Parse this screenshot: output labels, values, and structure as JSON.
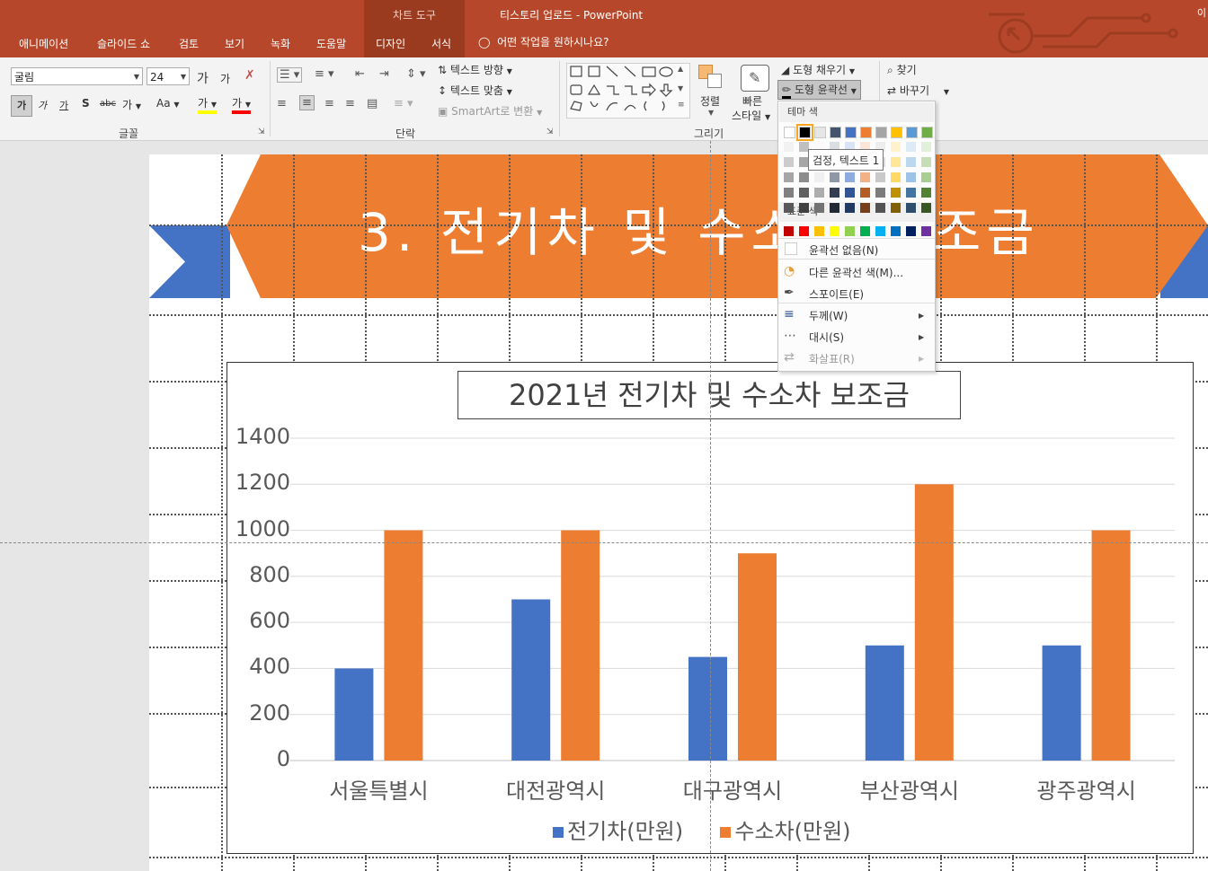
{
  "titlebar": {
    "tool_context": "차트 도구",
    "document_title": "티스토리 업로드  -  PowerPoint",
    "user": "이",
    "tabs": [
      "애니메이션",
      "슬라이드 쇼",
      "검토",
      "보기",
      "녹화",
      "도움말",
      "디자인",
      "서식"
    ],
    "tell_me": "어떤 작업을 원하시나요?",
    "accent": "#b7472a"
  },
  "ribbon": {
    "font": {
      "name": "굴림",
      "size": "24",
      "increase": "가",
      "decrease": "가",
      "bold": "가",
      "italic": "가",
      "underline": "가",
      "shadow": "S",
      "strike": "abc",
      "spacing": "가",
      "case": "Aa",
      "highlight": "가",
      "fontcolor": "가",
      "group_label": "글꼴"
    },
    "paragraph": {
      "text_direction": "텍스트 방향",
      "align_text": "텍스트 맞춤",
      "smartart": "SmartArt로 변환",
      "group_label": "단락"
    },
    "drawing": {
      "arrange": "정렬",
      "quick_styles_1": "빠른",
      "quick_styles_2": "스타일",
      "shape_fill": "도형 채우기",
      "shape_outline": "도형 윤곽선",
      "group_label": "그리기"
    },
    "editing": {
      "find": "찾기",
      "replace": "바꾸기"
    }
  },
  "slide": {
    "banner_title": "3. 전기차 및 수소차 보조금"
  },
  "outline_menu": {
    "theme_header": "테마 색",
    "standard_header": "표준 색",
    "tooltip": "검정, 텍스트 1",
    "items": [
      {
        "label": "윤곽선 없음(N)"
      },
      {
        "label": "다른 윤곽선 색(M)..."
      },
      {
        "label": "스포이트(E)"
      },
      {
        "label": "두께(W)"
      },
      {
        "label": "대시(S)"
      },
      {
        "label": "화살표(R)"
      }
    ],
    "theme_colors": [
      "#ffffff",
      "#000000",
      "#e7e6e6",
      "#44546a",
      "#4472c4",
      "#ed7d31",
      "#a5a5a5",
      "#ffc000",
      "#5b9bd5",
      "#70ad47"
    ],
    "standard_colors": [
      "#c00000",
      "#ff0000",
      "#ffc000",
      "#ffff00",
      "#92d050",
      "#00b050",
      "#00b0f0",
      "#0070c0",
      "#002060",
      "#7030a0"
    ]
  },
  "chart_data": {
    "type": "bar",
    "title": "2021년 전기차 및 수소차 보조금",
    "categories": [
      "서울특별시",
      "대전광역시",
      "대구광역시",
      "부산광역시",
      "광주광역시"
    ],
    "series": [
      {
        "name": "전기차(만원)",
        "color": "#4472c4",
        "values": [
          400,
          700,
          450,
          500,
          500
        ]
      },
      {
        "name": "수소차(만원)",
        "color": "#ed7d31",
        "values": [
          1000,
          1000,
          900,
          1200,
          1000
        ]
      }
    ],
    "ylim": [
      0,
      1400
    ],
    "yticks": [
      "1400",
      "1200",
      "1000",
      "800",
      "600",
      "400",
      "200",
      "0"
    ],
    "grid": true,
    "legend": "bottom"
  }
}
